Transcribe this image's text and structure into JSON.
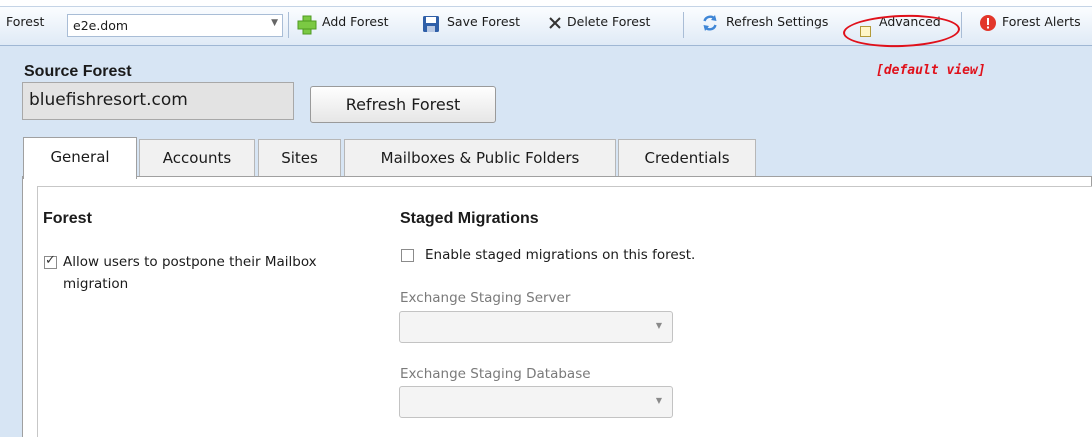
{
  "toolbar": {
    "forest_label": "Forest",
    "forest_value": "e2e.dom",
    "add_forest": "Add Forest",
    "save_forest": "Save Forest",
    "delete_forest": "Delete Forest",
    "refresh_settings": "Refresh Settings",
    "advanced": "Advanced",
    "advanced_checked": false,
    "forest_alerts": "Forest Alerts"
  },
  "source": {
    "title": "Source Forest",
    "value": "bluefishresort.com",
    "refresh_button": "Refresh Forest",
    "annotation": "[default view]"
  },
  "tabs": [
    {
      "label": "General",
      "active": true
    },
    {
      "label": "Accounts",
      "active": false
    },
    {
      "label": "Sites",
      "active": false
    },
    {
      "label": "Mailboxes & Public Folders",
      "active": false
    },
    {
      "label": "Credentials",
      "active": false
    }
  ],
  "forest_section": {
    "title": "Forest",
    "postpone_label_line1": "Allow users to postpone their Mailbox",
    "postpone_label_line2": "migration",
    "postpone_checked": true
  },
  "staged_section": {
    "title": "Staged Migrations",
    "enable_label": "Enable staged migrations on this forest.",
    "enable_checked": false,
    "server_label": "Exchange Staging Server",
    "server_value": "",
    "database_label": "Exchange Staging Database",
    "database_value": ""
  },
  "colors": {
    "background": "#d7e5f4",
    "annotation": "#e0101a"
  }
}
